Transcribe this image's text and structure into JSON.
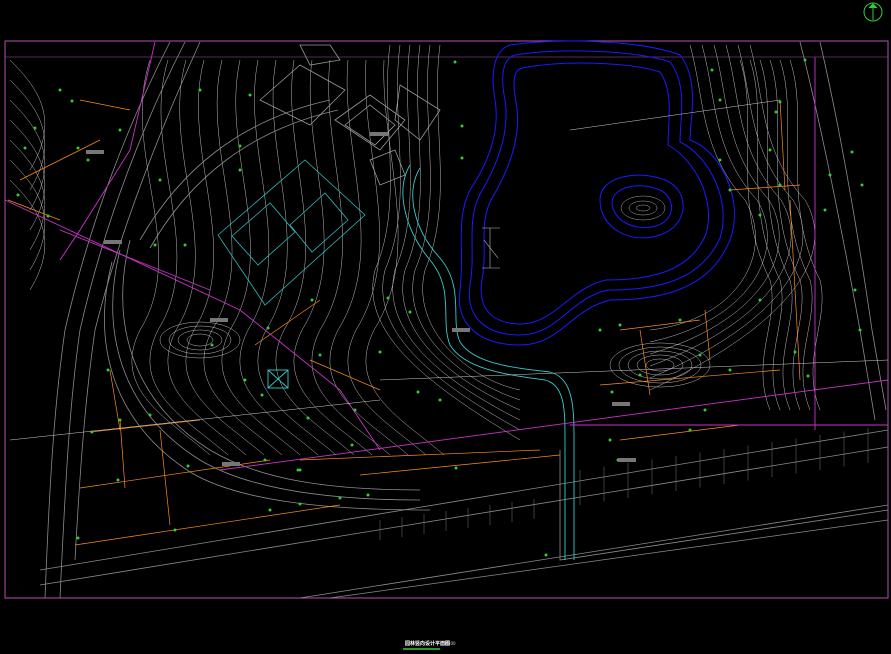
{
  "drawing": {
    "title": "园林竖向设计平面图",
    "scale": "1:500",
    "colors": {
      "background": "#000000",
      "frame": "#b34fb3",
      "contour": "#bdbdbd",
      "road": "#8c8c8c",
      "water": "#1a1aff",
      "stream": "#33cccc",
      "sports": "#2fb8b8",
      "slope": "#ff8c1a",
      "boundary": "#cc33cc",
      "point": "#33cc33",
      "north": "#33cc33"
    },
    "icons": [
      "north-arrow-icon",
      "survey-station-icon"
    ]
  }
}
